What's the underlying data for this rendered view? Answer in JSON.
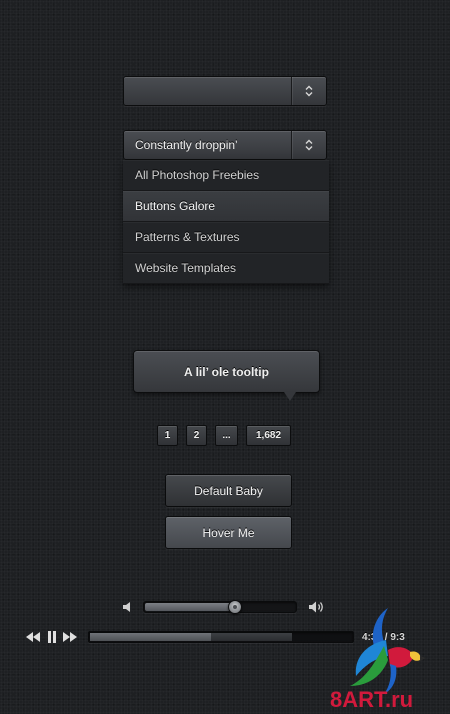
{
  "select_empty": {
    "value": ""
  },
  "select_open": {
    "value": "Constantly droppin’"
  },
  "dropdown": {
    "items": [
      {
        "label": "All Photoshop Freebies"
      },
      {
        "label": "Buttons Galore"
      },
      {
        "label": "Patterns & Textures"
      },
      {
        "label": "Website Templates"
      }
    ],
    "active_index": 1
  },
  "tooltip": {
    "text": "A lil’ ole tooltip"
  },
  "pagination": {
    "pages": [
      "1",
      "2",
      "...",
      "1,682"
    ]
  },
  "buttons": {
    "default_label": "Default Baby",
    "hover_label": "Hover Me"
  },
  "volume": {
    "level": 0.6
  },
  "player": {
    "time": "4:36 / 9:3",
    "progress": 0.46,
    "buffered": 0.77
  },
  "icons": {
    "select_arrow": "updown-chevron-icon",
    "volume_low": "speaker-low-icon",
    "volume_high": "speaker-high-icon",
    "rewind": "rewind-icon",
    "pause": "pause-icon",
    "forward": "fast-forward-icon"
  },
  "watermark": {
    "text": "8ART.ru"
  },
  "colors": {
    "background": "#1e2023",
    "text": "#f0f0f0",
    "watermark": "#d11a3c"
  }
}
